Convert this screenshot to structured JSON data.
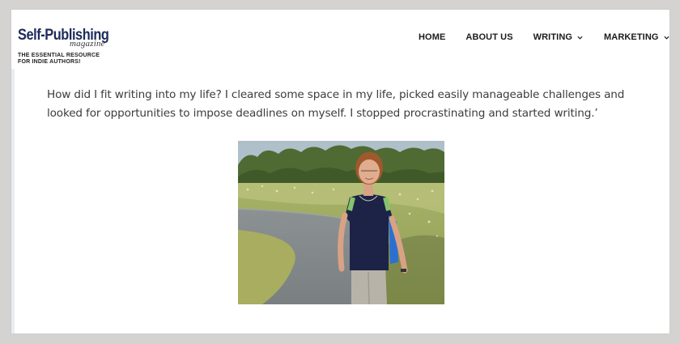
{
  "header": {
    "logo": {
      "title": "Self-Publishing",
      "subtitle": "magazine",
      "tagline_line1": "THE ESSENTIAL RESOURCE",
      "tagline_line2": "FOR INDIE AUTHORS!"
    },
    "nav": {
      "items": [
        {
          "label": "HOME",
          "has_dropdown": false
        },
        {
          "label": "ABOUT US",
          "has_dropdown": false
        },
        {
          "label": "WRITING",
          "has_dropdown": true
        },
        {
          "label": "MARKETING",
          "has_dropdown": true
        }
      ]
    }
  },
  "article": {
    "paragraph": "How did I fit writing into my life? I cleared some space in my life, picked easily manageable challenges and looked for opportunities to impose deadlines on myself. I stopped procrastinating and started writing.’"
  },
  "colors": {
    "background": "#d4d3d1",
    "page": "#ffffff",
    "logo_navy": "#1d2b59",
    "nav_text": "#1b1b1b",
    "body_text": "#3c3c3c"
  }
}
